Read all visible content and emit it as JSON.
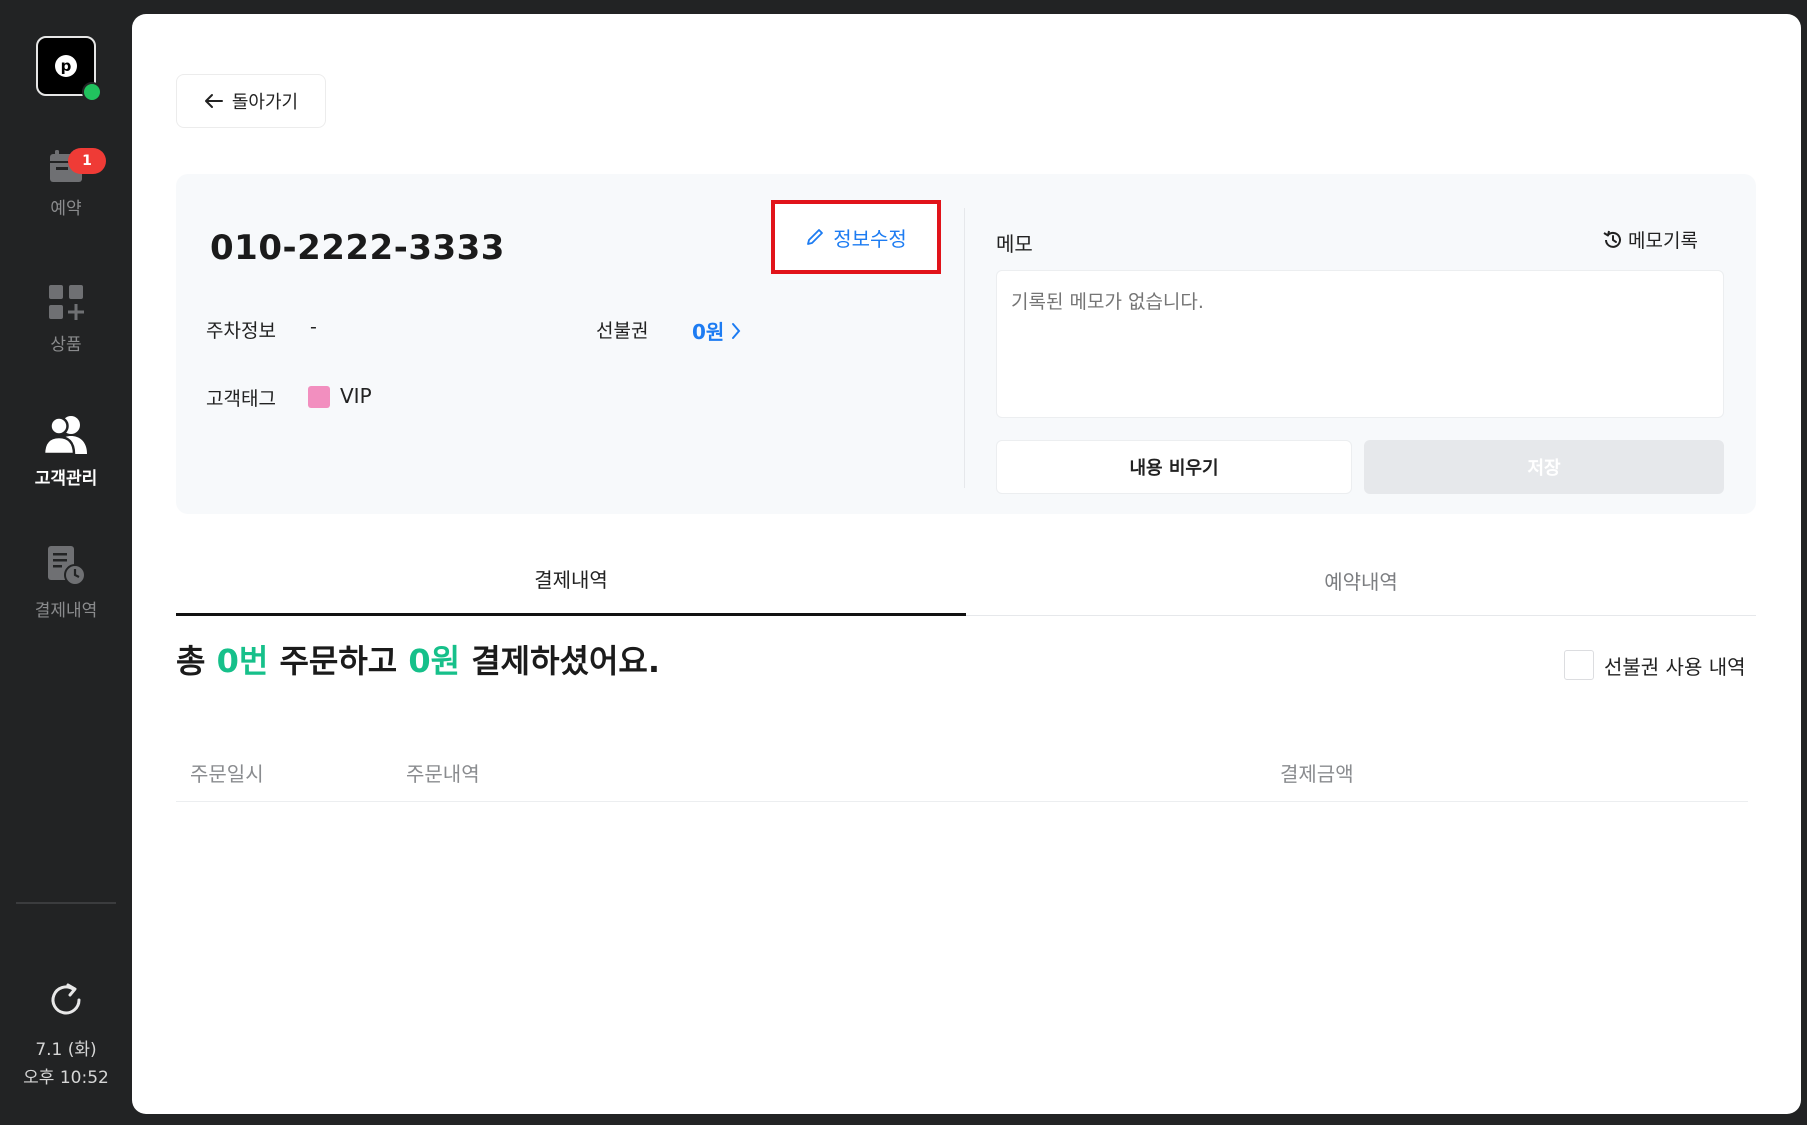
{
  "sidebar": {
    "logo_letter": "p",
    "items": [
      {
        "label": "예약",
        "icon": "calendar-icon",
        "badge": "1"
      },
      {
        "label": "상품",
        "icon": "grid-plus-icon"
      },
      {
        "label": "고객관리",
        "icon": "people-icon",
        "active": true
      },
      {
        "label": "결제내역",
        "icon": "receipt-clock-icon"
      }
    ],
    "date": "7.1 (화)",
    "time": "오후 10:52"
  },
  "back_label": "돌아가기",
  "customer": {
    "phone": "010-2222-3333",
    "edit_label": "정보수정",
    "parking_label": "주차정보",
    "parking_value": "-",
    "voucher_label": "선불권",
    "voucher_value": "0원",
    "tag_label": "고객태그",
    "tag_name": "VIP",
    "tag_color": "#f28fbf"
  },
  "memo": {
    "title": "메모",
    "history_label": "메모기록",
    "placeholder": "기록된 메모가 없습니다.",
    "clear_label": "내용 비우기",
    "save_label": "저장"
  },
  "tabs": [
    {
      "label": "결제내역",
      "active": true
    },
    {
      "label": "예약내역",
      "active": false
    }
  ],
  "summary": {
    "prefix": "총 ",
    "count": "0번",
    "middle": " 주문하고 ",
    "amount": "0원",
    "suffix": " 결제하셨어요."
  },
  "voucher_filter_label": "선불권 사용 내역",
  "table": {
    "columns": [
      "주문일시",
      "주문내역",
      "결제금액"
    ]
  },
  "colors": {
    "accent_blue": "#1d7cf2",
    "accent_green": "#16c08a",
    "badge_red": "#ef3b36",
    "online_green": "#21c25e"
  }
}
